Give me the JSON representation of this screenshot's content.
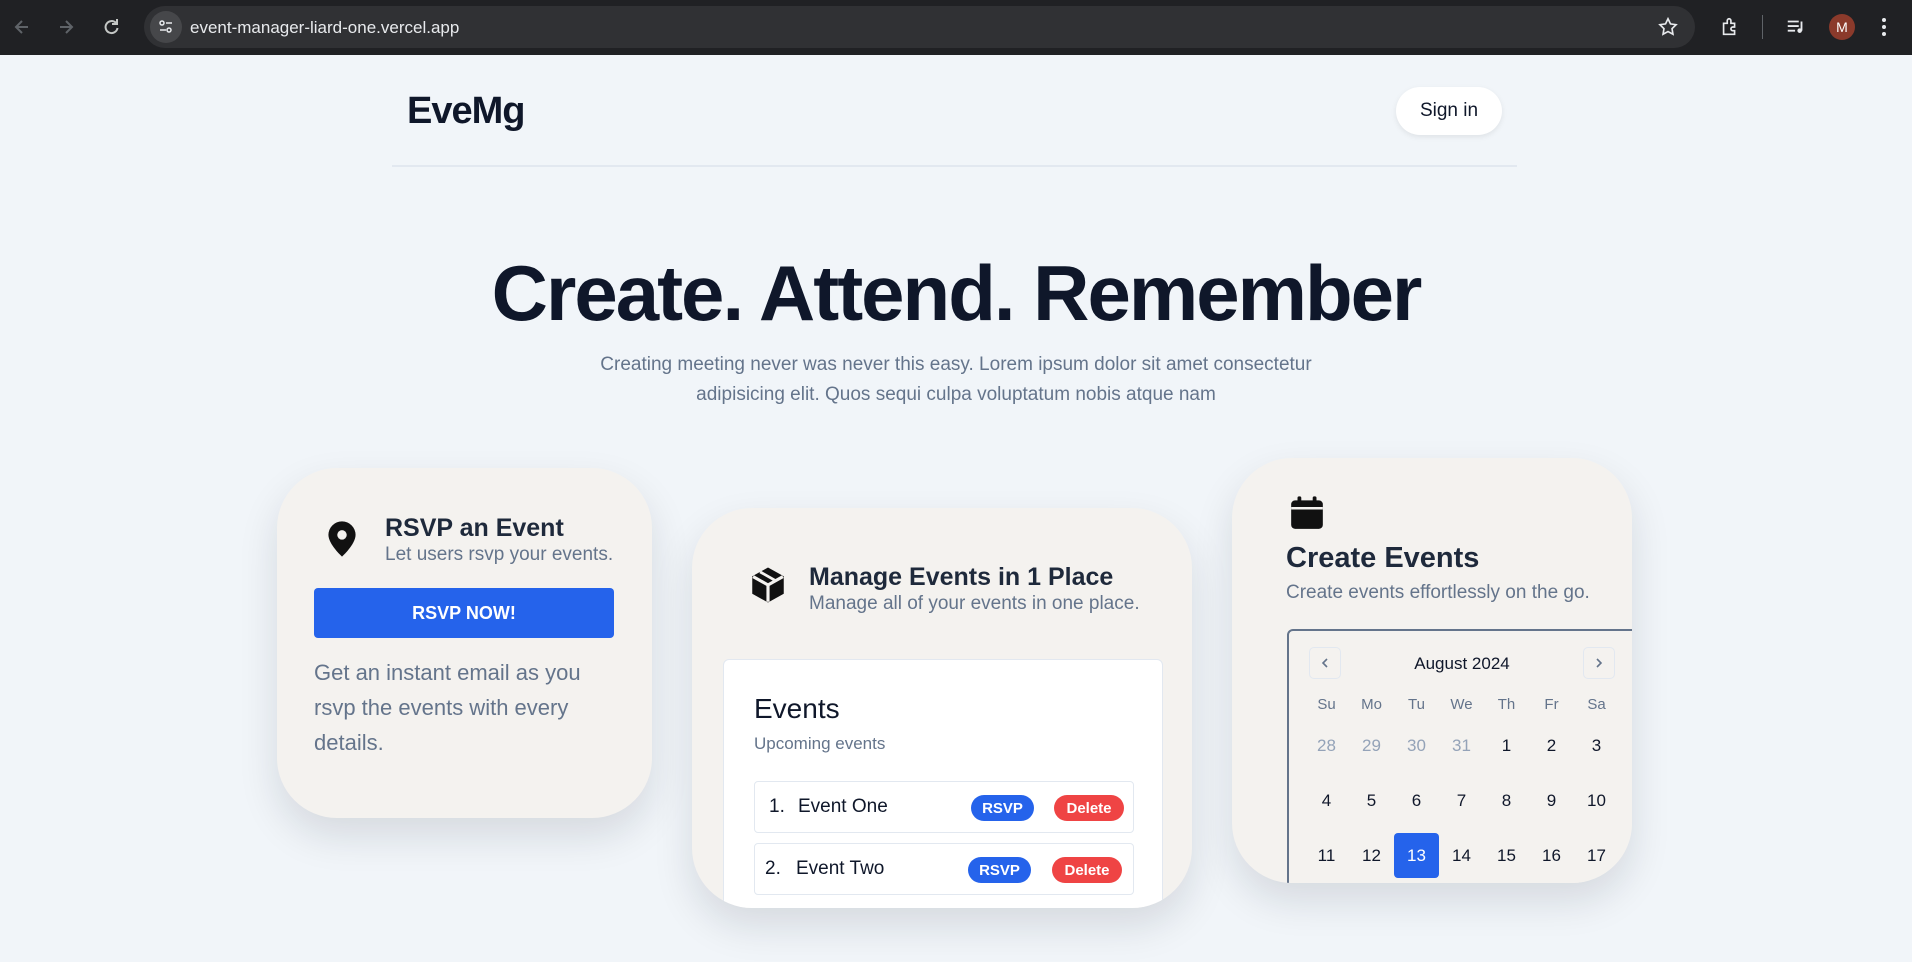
{
  "browser": {
    "url": "event-manager-liard-one.vercel.app",
    "profile_initial": "M"
  },
  "header": {
    "logo": "EveMg",
    "signin_label": "Sign in"
  },
  "hero": {
    "title": "Create. Attend. Remember",
    "subtitle_line1": "Creating meeting never was never this easy. Lorem ipsum dolor sit amet consectetur",
    "subtitle_line2": "adipisicing elit. Quos sequi culpa voluptatum nobis atque nam"
  },
  "rsvp_card": {
    "icon": "map-pin-icon",
    "title": "RSVP an Event",
    "subtitle": "Let users rsvp your events.",
    "button_label": "RSVP NOW!",
    "description": "Get an instant email as you rsvp the events with every details."
  },
  "manage_card": {
    "icon": "box-icon",
    "title": "Manage Events in 1 Place",
    "subtitle": "Manage all of your events in one place.",
    "panel_title": "Events",
    "panel_subtitle": "Upcoming events",
    "events": [
      {
        "number": "1.",
        "name": "Event One",
        "rsvp_label": "RSVP",
        "delete_label": "Delete"
      },
      {
        "number": "2.",
        "name": "Event Two",
        "rsvp_label": "RSVP",
        "delete_label": "Delete"
      }
    ]
  },
  "create_card": {
    "icon": "calendar-icon",
    "title": "Create Events",
    "subtitle": "Create events effortlessly on the go.",
    "calendar": {
      "month": "August 2024",
      "weekdays": [
        "Su",
        "Mo",
        "Tu",
        "We",
        "Th",
        "Fr",
        "Sa"
      ],
      "weeks": [
        [
          "28",
          "29",
          "30",
          "31",
          "1",
          "2",
          "3"
        ],
        [
          "4",
          "5",
          "6",
          "7",
          "8",
          "9",
          "10"
        ],
        [
          "11",
          "12",
          "13",
          "14",
          "15",
          "16",
          "17"
        ]
      ],
      "muted_days": [
        "28",
        "29",
        "30",
        "31"
      ],
      "selected_day": "13"
    }
  },
  "colors": {
    "accent": "#2563eb",
    "danger": "#ef4444",
    "page_bg": "#f1f5f9",
    "card_bg": "#f4f2ef"
  }
}
